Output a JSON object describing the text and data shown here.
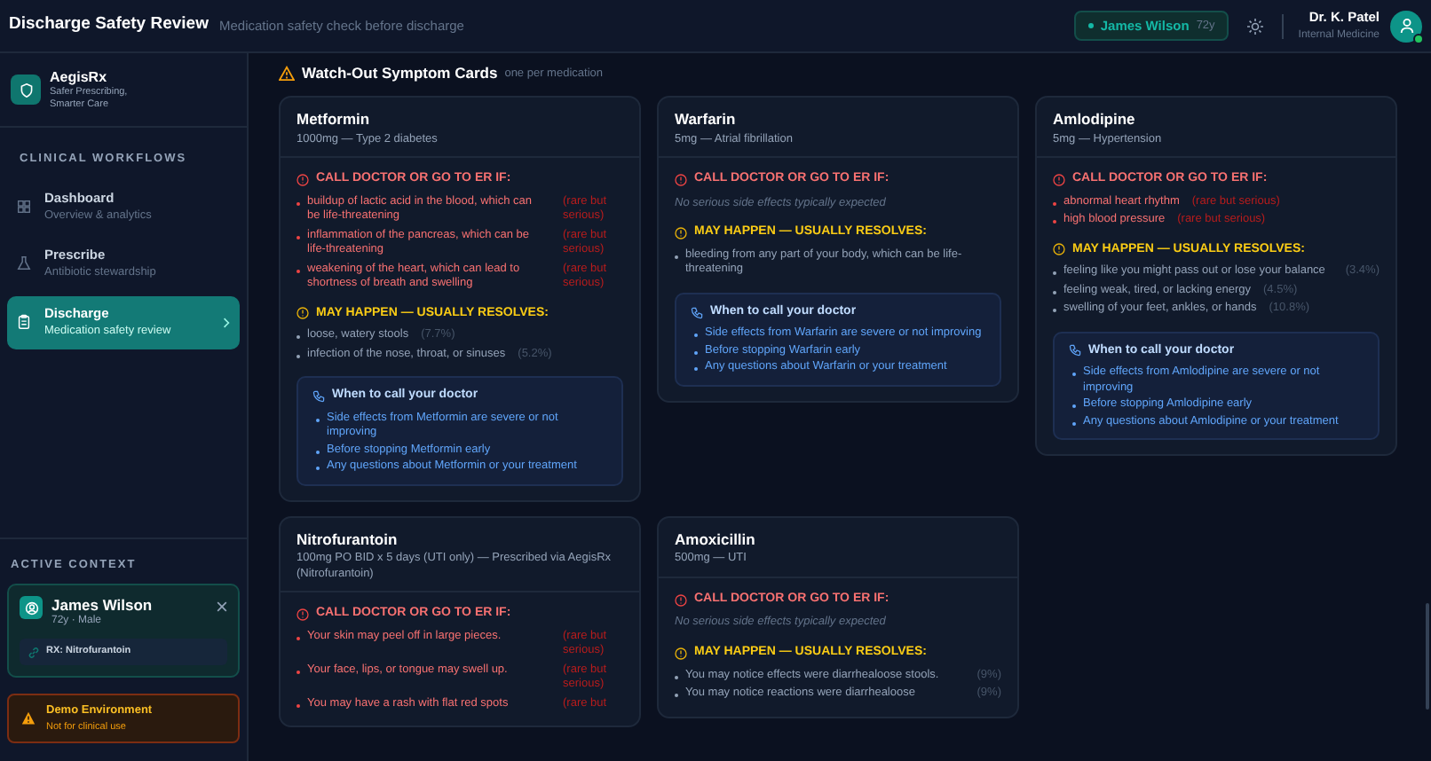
{
  "header": {
    "title": "Discharge Safety Review",
    "subtitle": "Medication safety check before discharge",
    "patient_chip": {
      "name": "James Wilson",
      "age": "72y"
    },
    "user": {
      "name": "Dr. K. Patel",
      "role": "Internal Medicine",
      "online": true
    }
  },
  "sidebar": {
    "brand": {
      "name": "AegisRx",
      "tagline": "Safer Prescribing, Smarter Care"
    },
    "section_title": "CLINICAL WORKFLOWS",
    "items": [
      {
        "kind": "dashboard",
        "label": "Dashboard",
        "sublabel": "Overview & analytics",
        "selected": false
      },
      {
        "kind": "prescribe",
        "label": "Prescribe",
        "sublabel": "Antibiotic stewardship",
        "selected": false
      },
      {
        "kind": "discharge",
        "label": "Discharge",
        "sublabel": "Medication safety review",
        "selected": true
      }
    ],
    "context_title": "ACTIVE CONTEXT",
    "patient": {
      "name": "James Wilson",
      "details": "72y · Male",
      "rx": "RX: Nitrofurantoin"
    },
    "notice": {
      "title": "Demo Environment",
      "text": "Not for clinical use"
    }
  },
  "main": {
    "title": "Watch-Out Symptom Cards",
    "subtitle": "one per medication",
    "cards": [
      {
        "name": "Metformin",
        "subtitle": "1000mg — Type 2 diabetes",
        "serious_title": "CALL DOCTOR OR GO TO ER IF:",
        "serious": [
          {
            "text": "buildup of lactic acid in the blood, which can be life-threatening",
            "note": "(rare but serious)"
          },
          {
            "text": "inflammation of the pancreas, which can be life-threatening",
            "note": "(rare but serious)"
          },
          {
            "text": "weakening of the heart, which can lead to shortness of breath and swelling",
            "note": "(rare but serious)"
          }
        ],
        "common_title": "MAY HAPPEN — USUALLY RESOLVES:",
        "common": [
          {
            "text": "loose, watery stools",
            "pct": "(7.7%)"
          },
          {
            "text": "infection of the nose, throat, or sinuses",
            "pct": "(5.2%)"
          }
        ],
        "doctor": {
          "title": "When to call your doctor",
          "items": [
            "Side effects from Metformin are severe or not improving",
            "Before stopping Metformin early",
            "Any questions about Metformin or your treatment"
          ]
        }
      },
      {
        "name": "Warfarin",
        "subtitle": "5mg — Atrial fibrillation",
        "serious_title": "CALL DOCTOR OR GO TO ER IF:",
        "serious_empty": "No serious side effects typically expected",
        "common_title": "MAY HAPPEN — USUALLY RESOLVES:",
        "common": [
          {
            "text": "bleeding from any part of your body, which can be life-threatening"
          }
        ],
        "doctor": {
          "title": "When to call your doctor",
          "items": [
            "Side effects from Warfarin are severe or not improving",
            "Before stopping Warfarin early",
            "Any questions about Warfarin or your treatment"
          ]
        }
      },
      {
        "name": "Amlodipine",
        "subtitle": "5mg — Hypertension",
        "serious_title": "CALL DOCTOR OR GO TO ER IF:",
        "serious": [
          {
            "text": "abnormal heart rhythm",
            "note": "(rare but serious)"
          },
          {
            "text": "high blood pressure",
            "note": "(rare but serious)"
          }
        ],
        "common_title": "MAY HAPPEN — USUALLY RESOLVES:",
        "common": [
          {
            "text": "feeling like you might pass out or lose your balance",
            "pct": "(3.4%)"
          },
          {
            "text": "feeling weak, tired, or lacking energy",
            "pct": "(4.5%)"
          },
          {
            "text": "swelling of your feet, ankles, or hands",
            "pct": "(10.8%)"
          }
        ],
        "doctor": {
          "title": "When to call your doctor",
          "items": [
            "Side effects from Amlodipine are severe or not improving",
            "Before stopping Amlodipine early",
            "Any questions about Amlodipine or your treatment"
          ]
        }
      },
      {
        "name": "Nitrofurantoin",
        "subtitle": "100mg PO BID x 5 days (UTI only) — Prescribed via AegisRx (Nitrofurantoin)",
        "serious_title": "CALL DOCTOR OR GO TO ER IF:",
        "serious": [
          {
            "text": "Your skin may peel off in large pieces.",
            "note": "(rare but serious)"
          },
          {
            "text": "Your face, lips, or tongue may swell up.",
            "note": "(rare but serious)"
          },
          {
            "text": "You may have a rash with flat red spots",
            "note": "(rare but"
          }
        ]
      },
      {
        "name": "Amoxicillin",
        "subtitle": "500mg — UTI",
        "serious_title": "CALL DOCTOR OR GO TO ER IF:",
        "serious_empty": "No serious side effects typically expected",
        "common_title": "MAY HAPPEN — USUALLY RESOLVES:",
        "common": [
          {
            "text": "You may notice effects were diarrhealoose stools.",
            "pct": "(9%)"
          },
          {
            "text": "You may notice reactions were diarrhealoose",
            "pct": "(9%)"
          }
        ]
      }
    ]
  }
}
